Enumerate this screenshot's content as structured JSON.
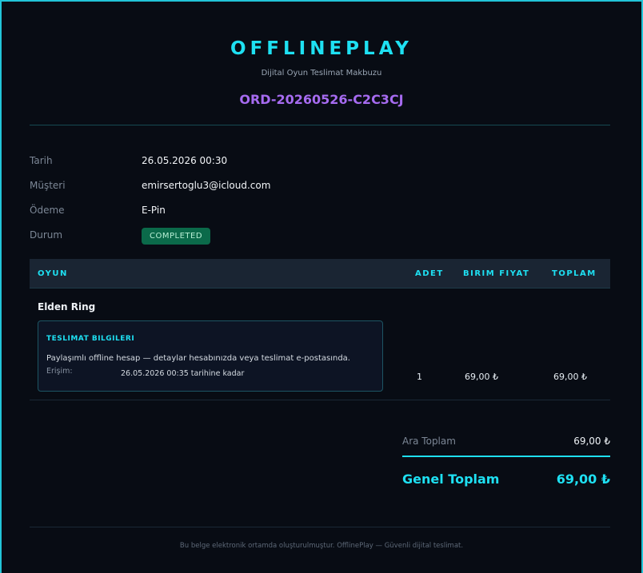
{
  "header": {
    "brand": "OFFLINEPLAY",
    "subtitle": "Dijital Oyun Teslimat Makbuzu",
    "order_id": "ORD-20260526-C2C3CJ"
  },
  "info": {
    "date_label": "Tarih",
    "date_value": "26.05.2026 00:30",
    "customer_label": "Müşteri",
    "customer_value": "emirsertoglu3@icloud.com",
    "payment_label": "Ödeme",
    "payment_value": "E-Pin",
    "status_label": "Durum",
    "status_value": "COMPLETED"
  },
  "table": {
    "headers": [
      "OYUN",
      "ADET",
      "BIRIM FIYAT",
      "TOPLAM"
    ],
    "rows": [
      {
        "game": "Elden Ring",
        "delivery_title": "TESLIMAT BILGILERI",
        "delivery_desc": "Paylaşımlı offline hesap — detaylar hesabınızda veya teslimat e-postasında.",
        "access_label": "Erişim:",
        "access_value": "26.05.2026 00:35 tarihine kadar",
        "qty": "1",
        "unit_price": "69,00 ₺",
        "total": "69,00 ₺"
      }
    ]
  },
  "totals": {
    "subtotal_label": "Ara Toplam",
    "subtotal_value": "69,00 ₺",
    "grand_label": "Genel Toplam",
    "grand_value": "69,00 ₺"
  },
  "footer": {
    "text": "Bu belge elektronik ortamda oluşturulmuştur. OfflinePlay — Güvenli dijital teslimat."
  },
  "colors": {
    "accent": "#1ee0f2",
    "order_id": "#a66bf0",
    "status_badge": "#0b6a4a"
  }
}
